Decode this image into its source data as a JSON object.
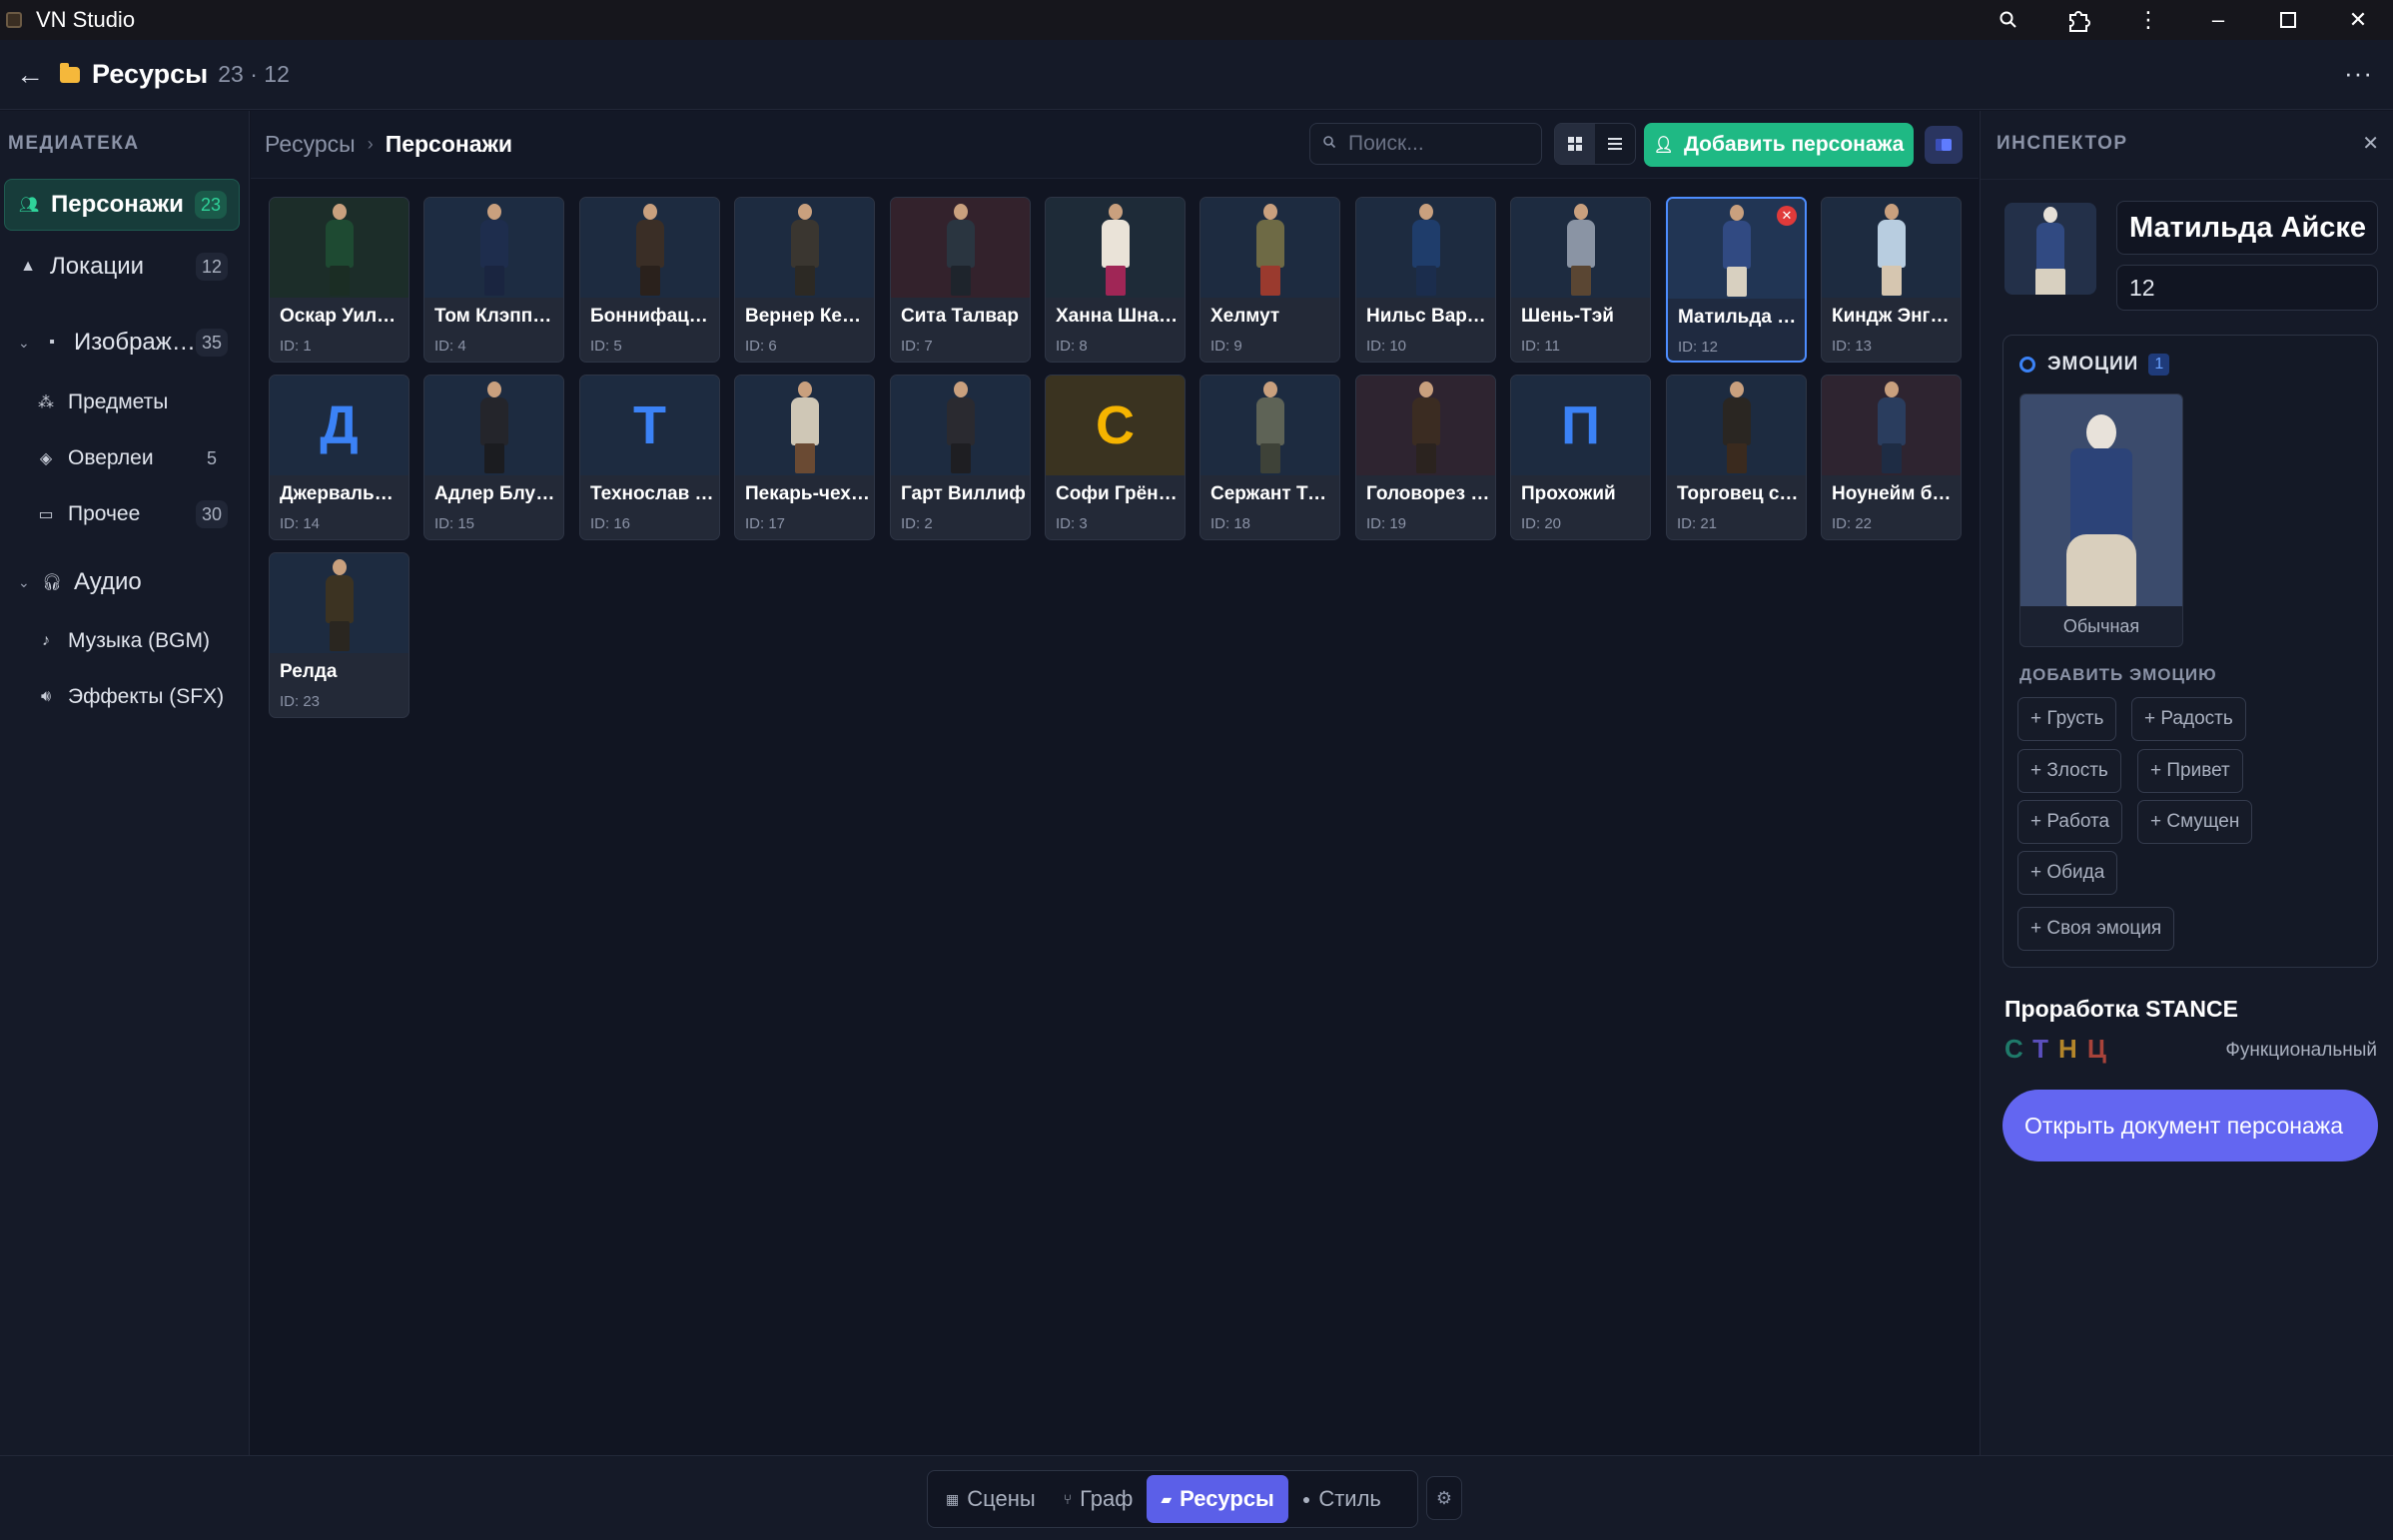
{
  "window": {
    "title": "VN Studio"
  },
  "header": {
    "title": "Ресурсы",
    "counts": "23 · 12"
  },
  "sidebar": {
    "heading": "МЕДИАТЕКА",
    "items": [
      {
        "label": "Персонажи",
        "count": "23",
        "icon": "users-icon"
      },
      {
        "label": "Локации",
        "count": "12",
        "icon": "mountain-icon"
      },
      {
        "label": "Изображ…",
        "count": "35",
        "icon": "image-icon"
      },
      {
        "label": "Предметы",
        "count": "",
        "icon": "shapes-icon"
      },
      {
        "label": "Оверлеи",
        "count": "5",
        "icon": "layers-icon"
      },
      {
        "label": "Прочее",
        "count": "30",
        "icon": "folder-icon"
      },
      {
        "label": "Аудио",
        "count": "",
        "icon": "headphones-icon"
      },
      {
        "label": "Музыка (BGM)",
        "count": "",
        "icon": "music-icon"
      },
      {
        "label": "Эффекты (SFX)",
        "count": "",
        "icon": "speaker-icon"
      }
    ]
  },
  "toolbar": {
    "crumb_root": "Ресурсы",
    "crumb_current": "Персонажи",
    "search_placeholder": "Поиск...",
    "add_label": "Добавить персонажа"
  },
  "characters": [
    {
      "name": "Оскар Уилл…",
      "id": "ID: 1",
      "bg": "#1c2d29",
      "body": "#1e4a32",
      "legs": "#1b2d24"
    },
    {
      "name": "Том Клэпп…",
      "id": "ID: 4",
      "bg": "#1d2c42",
      "body": "#1e2d4d",
      "legs": "#1a2540"
    },
    {
      "name": "Боннифаци…",
      "id": "ID: 5",
      "bg": "#1d2b40",
      "body": "#3a2e26",
      "legs": "#2a211c"
    },
    {
      "name": "Вернер Кер…",
      "id": "ID: 6",
      "bg": "#1d2b40",
      "body": "#3a3630",
      "legs": "#2c2924"
    },
    {
      "name": "Сита Талвар",
      "id": "ID: 7",
      "bg": "#33222c",
      "body": "#2a3540",
      "legs": "#1e242c"
    },
    {
      "name": "Ханна Шна…",
      "id": "ID: 8",
      "bg": "#1e2b38",
      "body": "#eae3d8",
      "legs": "#a02656"
    },
    {
      "name": "Хелмут",
      "id": "ID: 9",
      "bg": "#1d2b40",
      "body": "#6e6a45",
      "legs": "#9a3a2e"
    },
    {
      "name": "Нильс Варт…",
      "id": "ID: 10",
      "bg": "#1d2b40",
      "body": "#1f3d6b",
      "legs": "#1b2d4d"
    },
    {
      "name": "Шень-Тэй",
      "id": "ID: 11",
      "bg": "#1d2b40",
      "body": "#8a94a4",
      "legs": "#5a4633"
    },
    {
      "name": "Матильда …",
      "id": "ID: 12",
      "bg": "#213554",
      "body": "#314a82",
      "legs": "#d8d0c0",
      "selected": true
    },
    {
      "name": "Киндж Энг…",
      "id": "ID: 13",
      "bg": "#1d2b40",
      "body": "#b8cde0",
      "legs": "#d6c6b0"
    },
    {
      "name": "Джервальд…",
      "id": "ID: 14",
      "bg": "#1d2b40",
      "letter": "Д",
      "letter_color": "#3b82f6"
    },
    {
      "name": "Адлер Блут…",
      "id": "ID: 15",
      "bg": "#1d2b40",
      "body": "#24252b",
      "legs": "#1b1c20"
    },
    {
      "name": "Технослав …",
      "id": "ID: 16",
      "bg": "#1d2b40",
      "letter": "Т",
      "letter_color": "#3b82f6"
    },
    {
      "name": "Пекарь-чех…",
      "id": "ID: 17",
      "bg": "#1d2b40",
      "body": "#cfc7b6",
      "legs": "#6a4a33"
    },
    {
      "name": "Гарт Виллиф",
      "id": "ID: 2",
      "bg": "#1d2b40",
      "body": "#2a2a30",
      "legs": "#1e1e22"
    },
    {
      "name": "Софи Грён…",
      "id": "ID: 3",
      "bg": "#3a3320",
      "letter": "С",
      "letter_color": "#f5b400"
    },
    {
      "name": "Сержант Та…",
      "id": "ID: 18",
      "bg": "#1d2b40",
      "body": "#5e6356",
      "legs": "#3e4238"
    },
    {
      "name": "Головорез …",
      "id": "ID: 19",
      "bg": "#2e2430",
      "body": "#3b2c22",
      "legs": "#2b231f"
    },
    {
      "name": "Прохожий",
      "id": "ID: 20",
      "bg": "#1d2b40",
      "letter": "П",
      "letter_color": "#3b82f6"
    },
    {
      "name": "Торговец с…",
      "id": "ID: 21",
      "bg": "#1d2b40",
      "body": "#2a2622",
      "legs": "#3a2a1e"
    },
    {
      "name": "Ноунейм б…",
      "id": "ID: 22",
      "bg": "#2e2430",
      "body": "#2a3d5e",
      "legs": "#1e2c44"
    },
    {
      "name": "Релда",
      "id": "ID: 23",
      "bg": "#1d2b40",
      "body": "#3c3322",
      "legs": "#2a2620"
    }
  ],
  "inspector": {
    "heading": "ИНСПЕКТОР",
    "name": "Матильда Айскер",
    "id_value": "12",
    "emotions_label": "ЭМОЦИИ",
    "emotions_count": "1",
    "emotion_name": "Обычная",
    "add_emotion_label": "ДОБАВИТЬ ЭМОЦИЮ",
    "emotion_chips": [
      "+ Грусть",
      "+ Радость",
      "+ Злость",
      "+ Привет",
      "+ Работа",
      "+ Смущен",
      "+ Обида",
      "+ Своя эмоция"
    ],
    "stance_title": "Проработка STANCE",
    "stance_letters": [
      {
        "char": "С",
        "color": "#1f7a6a"
      },
      {
        "char": "Т",
        "color": "#5b4fbd"
      },
      {
        "char": "Н",
        "color": "#b4862a"
      },
      {
        "char": "Ц",
        "color": "#a8433a"
      }
    ],
    "stance_status": "Функциональный",
    "open_doc_label": "Открыть документ персонажа"
  },
  "bottom_tabs": [
    {
      "label": "Сцены",
      "icon": "grid-icon"
    },
    {
      "label": "Граф",
      "icon": "graph-icon"
    },
    {
      "label": "Ресурсы",
      "icon": "folder-icon",
      "active": true
    },
    {
      "label": "Стиль",
      "icon": "palette-icon"
    }
  ]
}
